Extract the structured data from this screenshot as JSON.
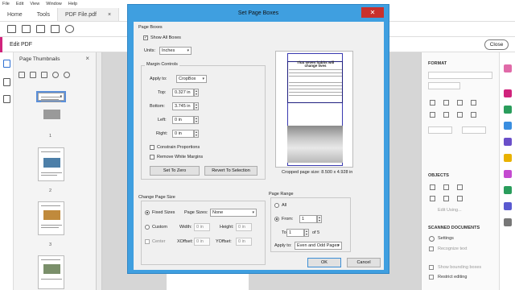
{
  "menu": [
    "File",
    "Edit",
    "View",
    "Window",
    "Help"
  ],
  "tabs": {
    "home": "Home",
    "tools": "Tools",
    "doc": "PDF File.pdf",
    "doc_close": "×"
  },
  "editbar": {
    "label": "Edit PDF",
    "close": "Close"
  },
  "thumbnails": {
    "title": "Page Thumbnails",
    "close": "×",
    "pages": [
      "1",
      "2",
      "3",
      "4"
    ]
  },
  "dialog": {
    "title": "Set Page Boxes",
    "close": "✕",
    "page_boxes": {
      "heading": "Page Boxes",
      "show_all_boxes": "Show All Boxes",
      "show_all_checked": true,
      "units_label": "Units:",
      "units_value": "Inches"
    },
    "margin_controls": {
      "heading": "Margin Controls",
      "apply_to_label": "Apply to:",
      "apply_to_value": "CropBox",
      "top_label": "Top:",
      "top_value": "0.327 in",
      "bottom_label": "Bottom:",
      "bottom_value": "3.745 in",
      "left_label": "Left:",
      "left_value": "0 in",
      "right_label": "Right:",
      "right_value": "0 in",
      "constrain": "Constrain Proportions",
      "remove_white": "Remove White Margins",
      "set_to_zero": "Set To Zero",
      "revert": "Revert To Selection"
    },
    "preview": {
      "heading": "That seven habits will change lives",
      "cropped_size": "Cropped page size: 8.500 x 4.928 in"
    },
    "change_page_size": {
      "heading": "Change Page Size",
      "fixed_sizes": "Fixed Sizes",
      "page_sizes_label": "Page Sizes:",
      "page_sizes_value": "None",
      "custom": "Custom",
      "width_label": "Width:",
      "width_value": "0 in",
      "height_label": "Height:",
      "height_value": "0 in",
      "center": "Center",
      "xoffset_label": "XOffset:",
      "xoffset_value": "0 in",
      "yoffset_label": "YOffset:",
      "yoffset_value": "0 in"
    },
    "page_range": {
      "heading": "Page Range",
      "all": "All",
      "from_label": "From:",
      "from_value": "1",
      "to_label": "To:",
      "to_value": "1",
      "of_label": "of 5",
      "apply_to_label": "Apply to:",
      "apply_to_value": "Even and Odd Pages"
    },
    "ok": "OK",
    "cancel": "Cancel"
  },
  "right_panel": {
    "format": "FORMAT",
    "objects": "OBJECTS",
    "edit_using": "Edit Using...",
    "scanned": "SCANNED DOCUMENTS",
    "settings": "Settings",
    "recognize": "Recognize text",
    "show_bounding": "Show bounding boxes",
    "restrict": "Restrict editing"
  },
  "colors": {
    "dialog_title": "#3f9fe0",
    "accent": "#d0237c",
    "selection": "#5b8fd9"
  }
}
